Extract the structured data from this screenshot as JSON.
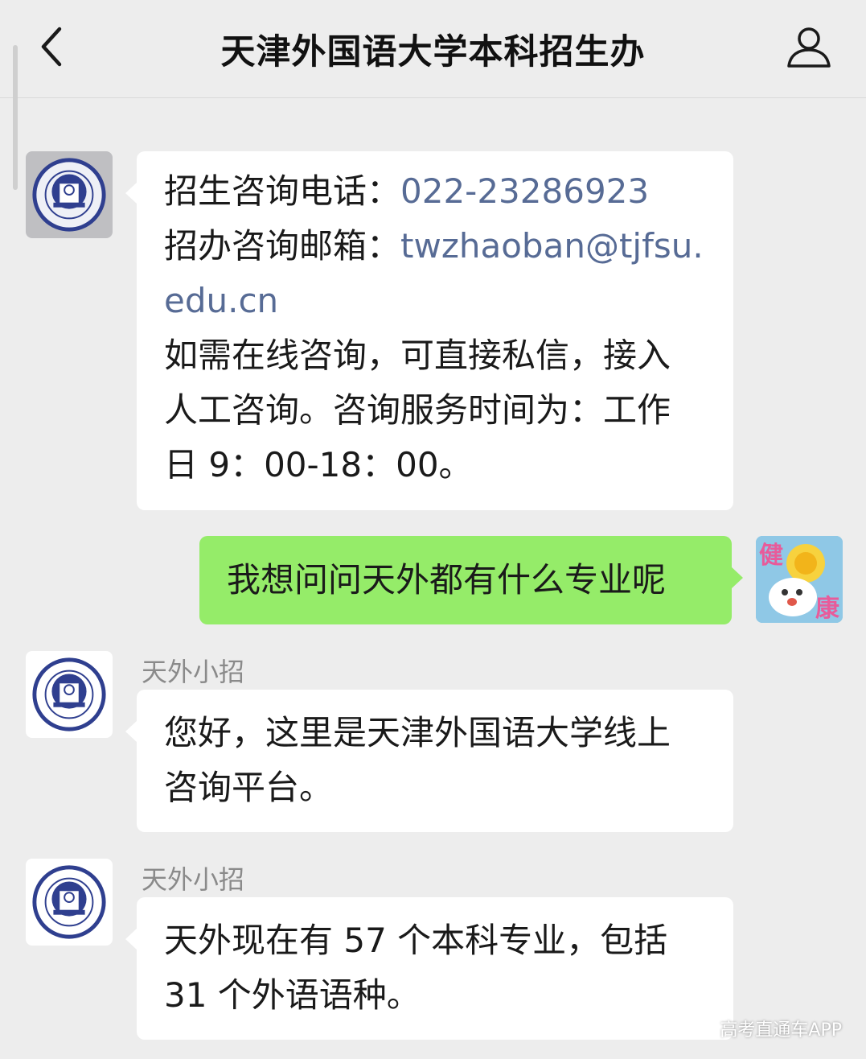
{
  "header": {
    "title": "天津外国语大学本科招生办"
  },
  "messages": {
    "m1": {
      "line1_label": "招生咨询电话：",
      "line1_value": "022-23286923",
      "line2_label": "招办咨询邮箱：",
      "line2_value_a": "twzhaoban@tjfsu.",
      "line2_value_b": "edu.cn",
      "line3": "如需在线咨询，可直接私信，接入",
      "line4": "人工咨询。咨询服务时间为：工作",
      "line5": "日 9：00-18：00。"
    },
    "m2": {
      "text": "我想问问天外都有什么专业呢"
    },
    "m3": {
      "sender": "天外小招",
      "line1": "您好，这里是天津外国语大学线上",
      "line2": "咨询平台。"
    },
    "m4": {
      "sender": "天外小招",
      "line1": "天外现在有 57 个本科专业，包括",
      "line2": "31 个外语语种。"
    }
  },
  "avatar": {
    "user_text_top": "健",
    "user_text_bottom": "康"
  },
  "watermark": "高考直通车APP",
  "colors": {
    "background": "#ededed",
    "incoming_bubble": "#ffffff",
    "outgoing_bubble": "#95ec69",
    "link": "#576b95",
    "school_logo": "#2f3f8f"
  }
}
